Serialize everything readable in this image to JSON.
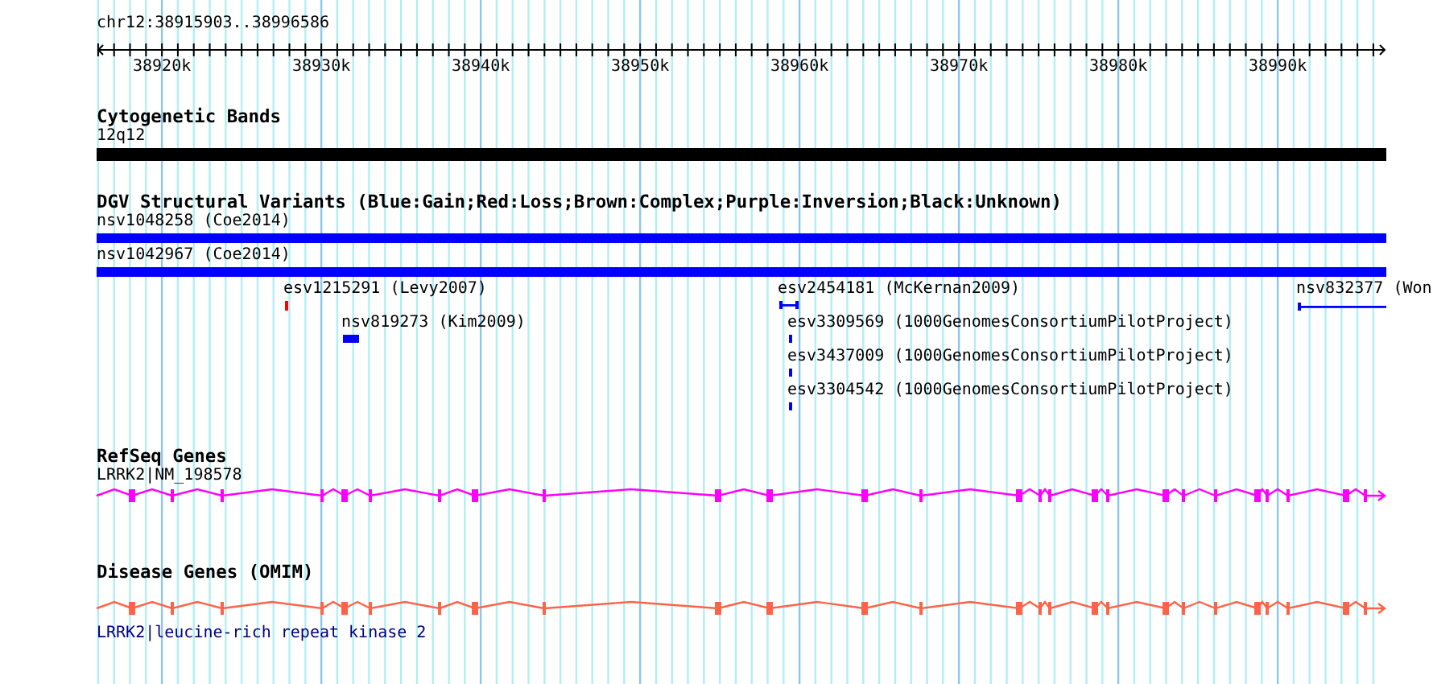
{
  "region": "chr12:38915903..38996586",
  "ruler": {
    "ticks": [
      "38920k",
      "38930k",
      "38940k",
      "38950k",
      "38960k",
      "38970k",
      "38980k",
      "38990k"
    ]
  },
  "tracks": [
    {
      "kind": "band",
      "title": "Cytogenetic Bands",
      "features": [
        {
          "label": "12q12"
        }
      ]
    },
    {
      "kind": "variants",
      "title": "DGV Structural Variants (Blue:Gain;Red:Loss;Brown:Complex;Purple:Inversion;Black:Unknown)",
      "features": [
        {
          "label": "nsv1048258 (Coe2014)",
          "color": "#0000ff"
        },
        {
          "label": "nsv1042967 (Coe2014)",
          "color": "#0000ff"
        },
        {
          "label": "esv1215291 (Levy2007)",
          "color": "#ff0000"
        },
        {
          "label": "esv2454181 (McKernan2009)",
          "color": "#0000ff"
        },
        {
          "label": "nsv832377 (Won",
          "color": "#0000ff"
        },
        {
          "label": "nsv819273 (Kim2009)",
          "color": "#0000ff"
        },
        {
          "label": "esv3309569 (1000GenomesConsortiumPilotProject)",
          "color": "#0000ff"
        },
        {
          "label": "esv3437009 (1000GenomesConsortiumPilotProject)",
          "color": "#0000ff"
        },
        {
          "label": "esv3304542 (1000GenomesConsortiumPilotProject)",
          "color": "#0000ff"
        }
      ]
    },
    {
      "kind": "gene",
      "title": "RefSeq Genes",
      "features": [
        {
          "label": "LRRK2|NM_198578",
          "color": "#ff00ff"
        }
      ]
    },
    {
      "kind": "gene_below",
      "title": "Disease Genes (OMIM)",
      "features": [
        {
          "label": "LRRK2|leucine-rich repeat kinase 2",
          "color": "#ff6347"
        }
      ]
    }
  ]
}
